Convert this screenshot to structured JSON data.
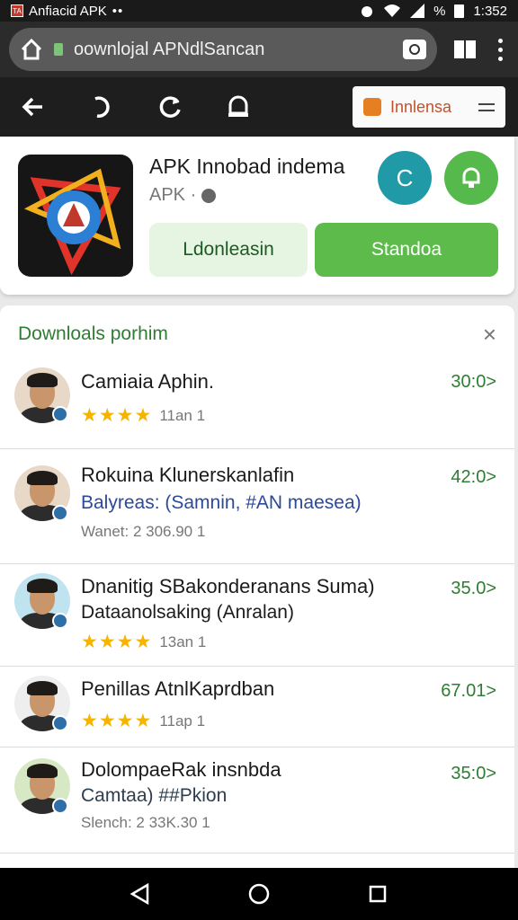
{
  "status_bar": {
    "app_icon_text": "TA",
    "title": "Anfiacid APK",
    "dots": "••",
    "signal_text": "%",
    "time": "1:352"
  },
  "browser": {
    "url": "oownlojal APNdlSancan"
  },
  "toolbar": {
    "language_label": "Innlensa"
  },
  "app": {
    "title": "APK Innobad indema",
    "subtitle": "APK ·",
    "teal_button_label": "C",
    "left_button_label": "Ldonleasin",
    "right_button_label": "Standoa"
  },
  "list": {
    "header": "Downloals porhim",
    "close_glyph": "×",
    "items": [
      {
        "title": "Camiaia Aphin.",
        "subtitle": "",
        "stars": "★★★★",
        "meta": "11an 1",
        "price": "30:0>",
        "subtitle_color": "#2e7d32"
      },
      {
        "title": "Rokuina Klunerskanlafin",
        "subtitle": "Balyreas: (Samnin, #AN maesea)",
        "stars": "",
        "meta": "Wanet: 2 306.90 1",
        "price": "42:0>"
      },
      {
        "title": "Dnanitig SBakonderanans Suma)",
        "subtitle": "Dataanolsaking (Anralan)",
        "stars": "★★★★",
        "meta": "13an 1",
        "price": "35.0>"
      },
      {
        "title": "Penillas AtnlKaprdban",
        "subtitle": "",
        "stars": "★★★★",
        "meta": "11ap 1",
        "price": "67.01>"
      },
      {
        "title": "DolompaeRak insnbda",
        "subtitle": "Camtaa) ##Pkion",
        "stars": "",
        "meta": "Slench: 2 33K.30 1",
        "price": "35:0>"
      }
    ]
  },
  "colors": {
    "accent_green": "#5dbb4b",
    "teal": "#1f9aa6",
    "star": "#f5b400",
    "price_green": "#2e7d32"
  },
  "icons": [
    "home-icon",
    "lock-icon",
    "camera-icon",
    "tabs-icon",
    "overflow-menu-icon",
    "back-icon",
    "undo-icon",
    "refresh-icon",
    "bell-icon",
    "flag-icon",
    "hamburger-icon",
    "star-icon",
    "back-nav-icon",
    "home-nav-icon",
    "recents-nav-icon"
  ]
}
